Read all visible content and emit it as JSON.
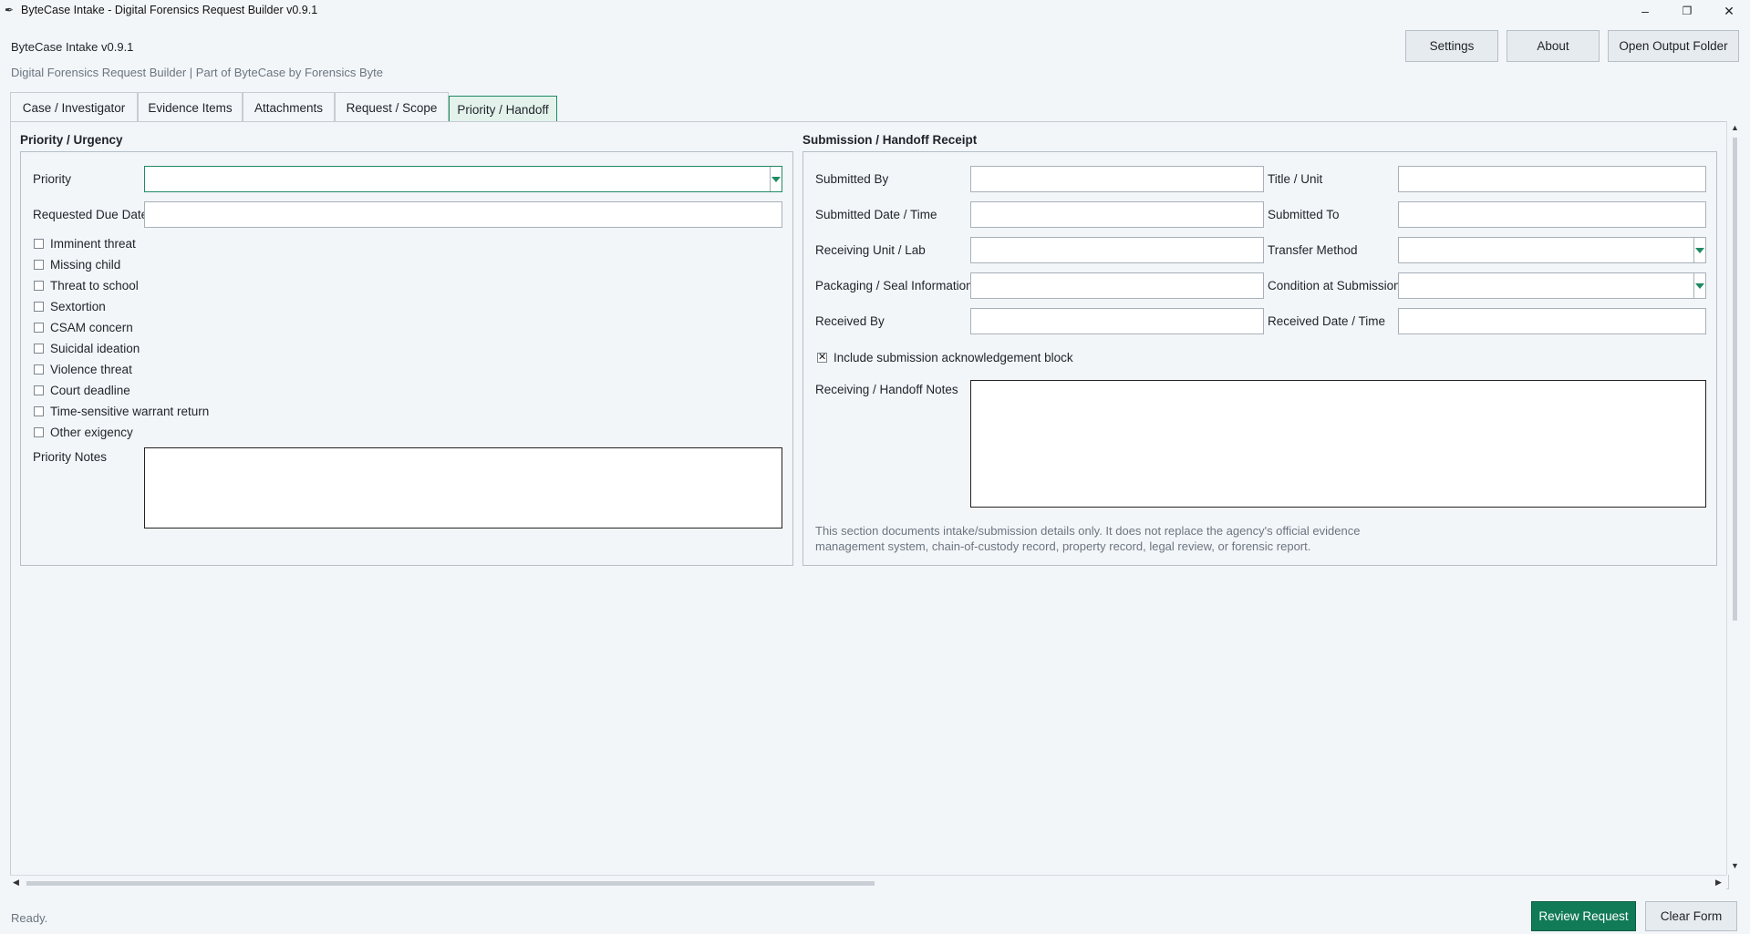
{
  "window": {
    "title": "ByteCase Intake - Digital Forensics Request Builder v0.9.1",
    "minimize": "–",
    "maximize": "❐",
    "close": "✕"
  },
  "header": {
    "app_name": "ByteCase Intake v0.9.1",
    "subtitle": "Digital Forensics Request Builder | Part of ByteCase by Forensics Byte",
    "buttons": {
      "settings": "Settings",
      "about": "About",
      "open_output": "Open Output Folder"
    }
  },
  "tabs": [
    {
      "label": "Case / Investigator"
    },
    {
      "label": "Evidence Items"
    },
    {
      "label": "Attachments"
    },
    {
      "label": "Request / Scope"
    },
    {
      "label": "Priority / Handoff",
      "active": true
    }
  ],
  "priority": {
    "group_title": "Priority / Urgency",
    "priority_label": "Priority",
    "priority_value": "",
    "due_date_label": "Requested Due Date",
    "due_date_value": "",
    "exigencies": [
      {
        "label": "Imminent threat",
        "checked": false
      },
      {
        "label": "Missing child",
        "checked": false
      },
      {
        "label": "Threat to school",
        "checked": false
      },
      {
        "label": "Sextortion",
        "checked": false
      },
      {
        "label": "CSAM concern",
        "checked": false
      },
      {
        "label": "Suicidal ideation",
        "checked": false
      },
      {
        "label": "Violence threat",
        "checked": false
      },
      {
        "label": "Court deadline",
        "checked": false
      },
      {
        "label": "Time-sensitive warrant return",
        "checked": false
      },
      {
        "label": "Other exigency",
        "checked": false
      }
    ],
    "notes_label": "Priority Notes",
    "notes_value": ""
  },
  "handoff": {
    "group_title": "Submission / Handoff Receipt",
    "submitted_by_label": "Submitted By",
    "title_unit_label": "Title / Unit",
    "submitted_datetime_label": "Submitted Date / Time",
    "submitted_to_label": "Submitted To",
    "receiving_unit_label": "Receiving Unit / Lab",
    "transfer_method_label": "Transfer Method",
    "packaging_label": "Packaging / Seal Information",
    "condition_label": "Condition at Submission",
    "received_by_label": "Received By",
    "received_datetime_label": "Received Date / Time",
    "ack_label": "Include submission acknowledgement block",
    "ack_checked": true,
    "notes_label": "Receiving / Handoff Notes",
    "disclaimer_line1": "This section documents intake/submission details only. It does not replace the agency's official evidence",
    "disclaimer_line2": "management system, chain-of-custody record, property record, legal review, or forensic report."
  },
  "footer": {
    "status": "Ready.",
    "review": "Review Request",
    "clear": "Clear Form"
  },
  "colors": {
    "accent": "#117a57",
    "accent_light": "#e3f3ec",
    "background": "#f3f6f9"
  }
}
